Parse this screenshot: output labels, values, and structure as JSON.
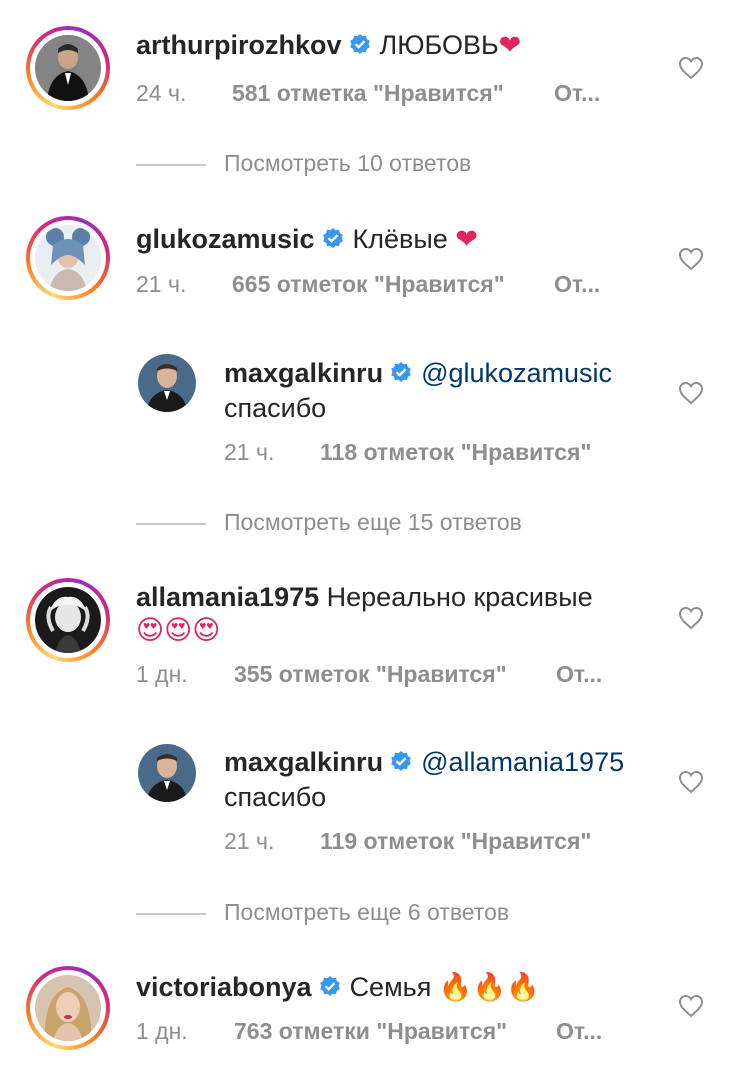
{
  "comments": [
    {
      "username": "arthurpirozhkov",
      "text": "ЛЮБОВЬ",
      "emoji": "❤",
      "time": "24 ч.",
      "likes": "581 отметка \"Нравится\"",
      "reply": "От..."
    },
    {
      "username": "glukozamusic",
      "text": "Клёвые",
      "emoji": "❤",
      "time": "21 ч.",
      "likes": "665 отметок \"Нравится\"",
      "reply": "От..."
    },
    {
      "username": "allamania1975",
      "text": "Нереально красивые",
      "emoji": "😍😍😍",
      "time": "1 дн.",
      "likes": "355 отметок \"Нравится\"",
      "reply": "От..."
    },
    {
      "username": "victoriabonya",
      "text": "Семья",
      "emoji": "🔥🔥🔥",
      "time": "1 дн.",
      "likes": "763 отметки \"Нравится\"",
      "reply": "От..."
    }
  ],
  "replies": [
    {
      "username": "maxgalkinru",
      "mention": "@glukozamusic",
      "text": "спасибо",
      "time": "21 ч.",
      "likes": "118 отметок \"Нравится\""
    },
    {
      "username": "maxgalkinru",
      "mention": "@allamania1975",
      "text": "спасибо",
      "time": "21 ч.",
      "likes": "119 отметок \"Нравится\""
    }
  ],
  "view_replies": [
    "Посмотреть 10 ответов",
    "Посмотреть еще 15 ответов",
    "Посмотреть еще 6 ответов"
  ],
  "colors": {
    "text": "#262626",
    "secondary": "#8e8e8e",
    "mention": "#00376b",
    "verified": "#3897f0",
    "heart_emoji": "#e0245e"
  },
  "icons": {
    "verified": "verified-badge-icon",
    "like": "heart-outline-icon"
  }
}
